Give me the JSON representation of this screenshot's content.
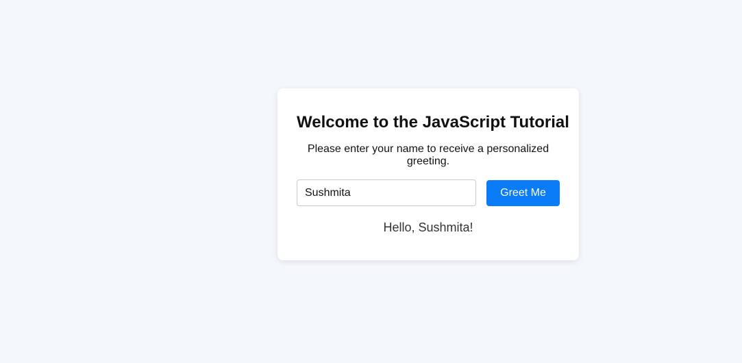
{
  "card": {
    "title": "Welcome to the JavaScript Tutorial",
    "subtitle": "Please enter your name to receive a personalized greeting.",
    "name_input": {
      "value": "Sushmita",
      "placeholder": ""
    },
    "greet_button_label": "Greet Me",
    "greeting_text": "Hello, Sushmita!"
  },
  "colors": {
    "page_background": "#f4f7fb",
    "card_background": "#ffffff",
    "button_background": "#0a7cf8",
    "button_text": "#ffffff"
  }
}
